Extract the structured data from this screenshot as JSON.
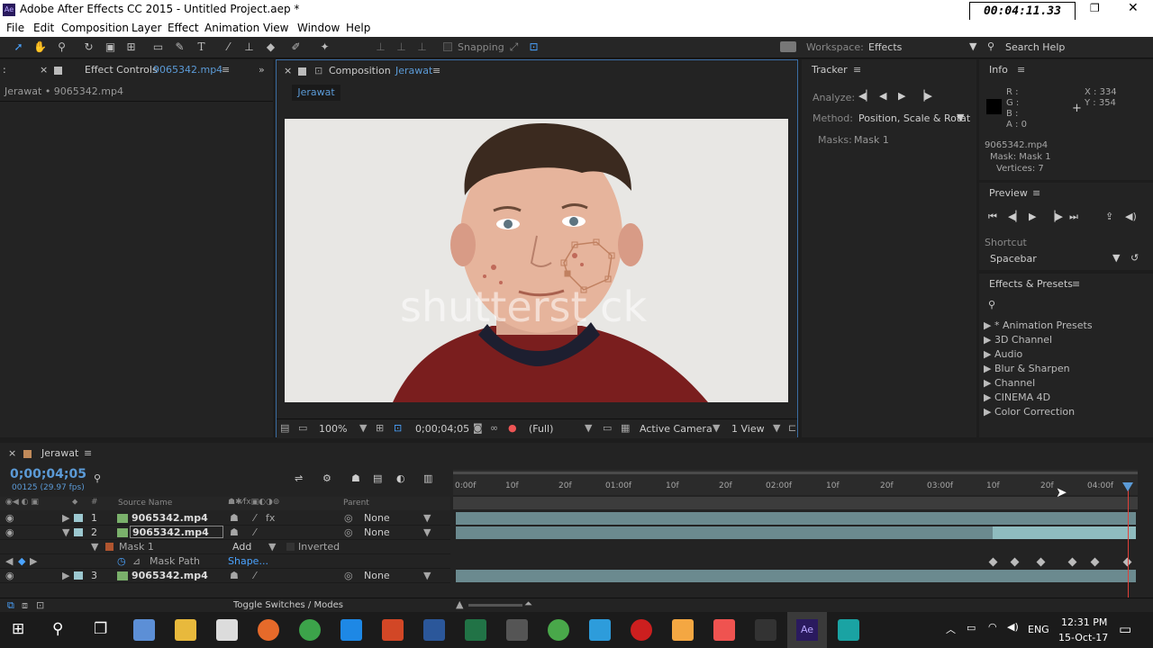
{
  "app": {
    "title": "Adobe After Effects CC 2015 - Untitled Project.aep *",
    "timecode_overlay": "00:04:11.33",
    "logo": "Ae"
  },
  "menu": [
    "File",
    "Edit",
    "Composition",
    "Layer",
    "Effect",
    "Animation",
    "View",
    "Window",
    "Help"
  ],
  "toolbar": {
    "snapping": "Snapping",
    "workspace_label": "Workspace:",
    "workspace_value": "Effects",
    "search_help": "Search Help"
  },
  "effect_controls": {
    "tab": "Effect Controls",
    "file": "9065342.mp4",
    "breadcrumb": "Jerawat • 9065342.mp4"
  },
  "composition": {
    "tab_label": "Composition",
    "name": "Jerawat",
    "sub_tab": "Jerawat",
    "watermark": "shutterst ck",
    "zoom": "100%",
    "time": "0;00;04;05",
    "resolution": "(Full)",
    "camera": "Active Camera",
    "views": "1 View"
  },
  "tracker": {
    "title": "Tracker",
    "analyze": "Analyze:",
    "method_label": "Method:",
    "method_value": "Position, Scale & Rotat",
    "masks_label": "Masks:",
    "masks_value": "Mask 1"
  },
  "info": {
    "title": "Info",
    "r": "R :",
    "g": "G :",
    "b": "B :",
    "a": "A : 0",
    "x": "X : 334",
    "y": "Y : 354",
    "line1": "9065342.mp4",
    "line2": "Mask: Mask 1",
    "line3": "Vertices: 7"
  },
  "preview": {
    "title": "Preview",
    "shortcut_label": "Shortcut",
    "shortcut_value": "Spacebar"
  },
  "effects_presets": {
    "title": "Effects & Presets",
    "items": [
      "* Animation Presets",
      "3D Channel",
      "Audio",
      "Blur & Sharpen",
      "Channel",
      "CINEMA 4D",
      "Color Correction"
    ]
  },
  "timeline": {
    "tab": "Jerawat",
    "time": "0;00;04;05",
    "fps": "00125 (29.97 fps)",
    "col_source": "Source Name",
    "col_parent": "Parent",
    "ruler": [
      "0:00f",
      "10f",
      "20f",
      "01:00f",
      "10f",
      "20f",
      "02:00f",
      "10f",
      "20f",
      "03:00f",
      "10f",
      "20f",
      "04:00f"
    ],
    "layers": [
      {
        "num": "1",
        "name": "9065342.mp4",
        "parent": "None"
      },
      {
        "num": "2",
        "name": "9065342.mp4",
        "parent": "None"
      },
      {
        "num": "3",
        "name": "9065342.mp4",
        "parent": "None"
      }
    ],
    "mask": {
      "name": "Mask 1",
      "mode": "Add",
      "inverted": "Inverted",
      "path": "Mask Path",
      "shape": "Shape..."
    },
    "footer": "Toggle Switches / Modes"
  },
  "taskbar": {
    "time": "12:31 PM",
    "date": "15-Oct-17",
    "lang": "ENG"
  }
}
